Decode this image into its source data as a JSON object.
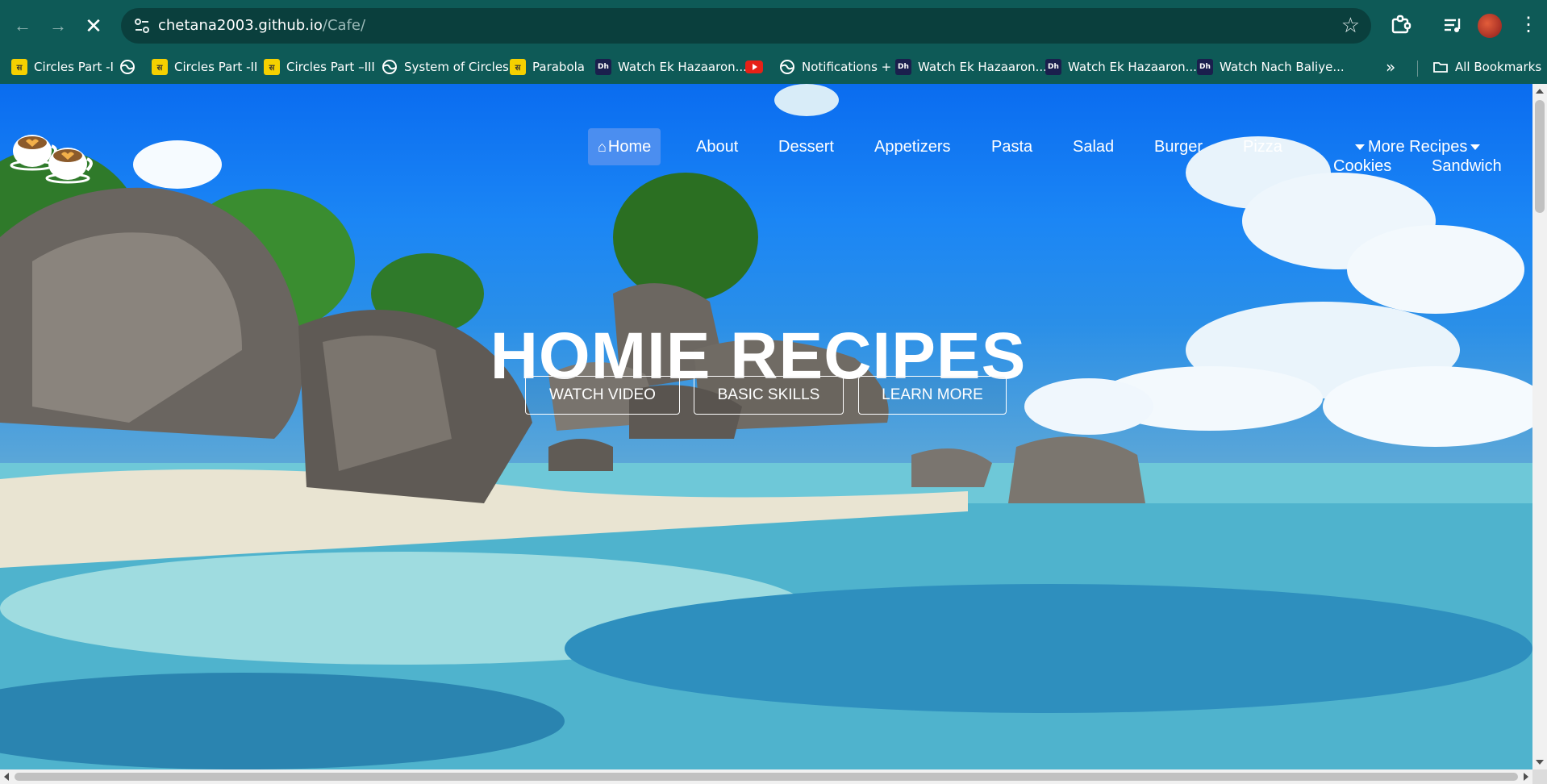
{
  "browser": {
    "url_host": "chetana2003.github.io",
    "url_path": "/Cafe/",
    "back_icon": "arrow-left-icon",
    "forward_icon": "arrow-right-icon",
    "stop_icon": "close-icon",
    "bookmarks": [
      {
        "label": "Circles Part -I",
        "icon": "yellow-site-icon"
      },
      {
        "label": "",
        "icon": "globe-icon"
      },
      {
        "label": "Circles Part -II",
        "icon": "yellow-site-icon"
      },
      {
        "label": "Circles Part –III",
        "icon": "yellow-site-icon"
      },
      {
        "label": "System of Circles",
        "icon": "globe-icon"
      },
      {
        "label": "Parabola",
        "icon": "yellow-site-icon"
      },
      {
        "label": "Watch Ek Hazaaron...",
        "icon": "dh-icon"
      },
      {
        "label": "",
        "icon": "youtube-icon"
      },
      {
        "label": "Notifications +",
        "icon": "globe-icon"
      },
      {
        "label": "Watch Ek Hazaaron...",
        "icon": "dh-icon"
      },
      {
        "label": "Watch Ek Hazaaron...",
        "icon": "dh-icon"
      },
      {
        "label": "Watch Nach Baliye...",
        "icon": "dh-icon"
      }
    ],
    "all_bookmarks_label": "All Bookmarks",
    "more_bookmarks_label": "»",
    "dh_badge": "Dh"
  },
  "site": {
    "nav": {
      "home": "Home",
      "about": "About",
      "dessert": "Dessert",
      "appetizers": "Appetizers",
      "pasta": "Pasta",
      "salad": "Salad",
      "burger": "Burger",
      "pizza": "Pizza",
      "more_recipes": "More Recipes",
      "cookies": "Cookies",
      "sandwich": "Sandwich"
    },
    "hero": {
      "title": "HOMIE RECIPES",
      "buttons": [
        "WATCH VIDEO",
        "BASIC SKILLS",
        "LEARN MORE"
      ]
    }
  },
  "colors": {
    "chrome": "#0e5a57",
    "omnibox": "#0a3f3d",
    "nav_active": "#4b8ef0"
  }
}
